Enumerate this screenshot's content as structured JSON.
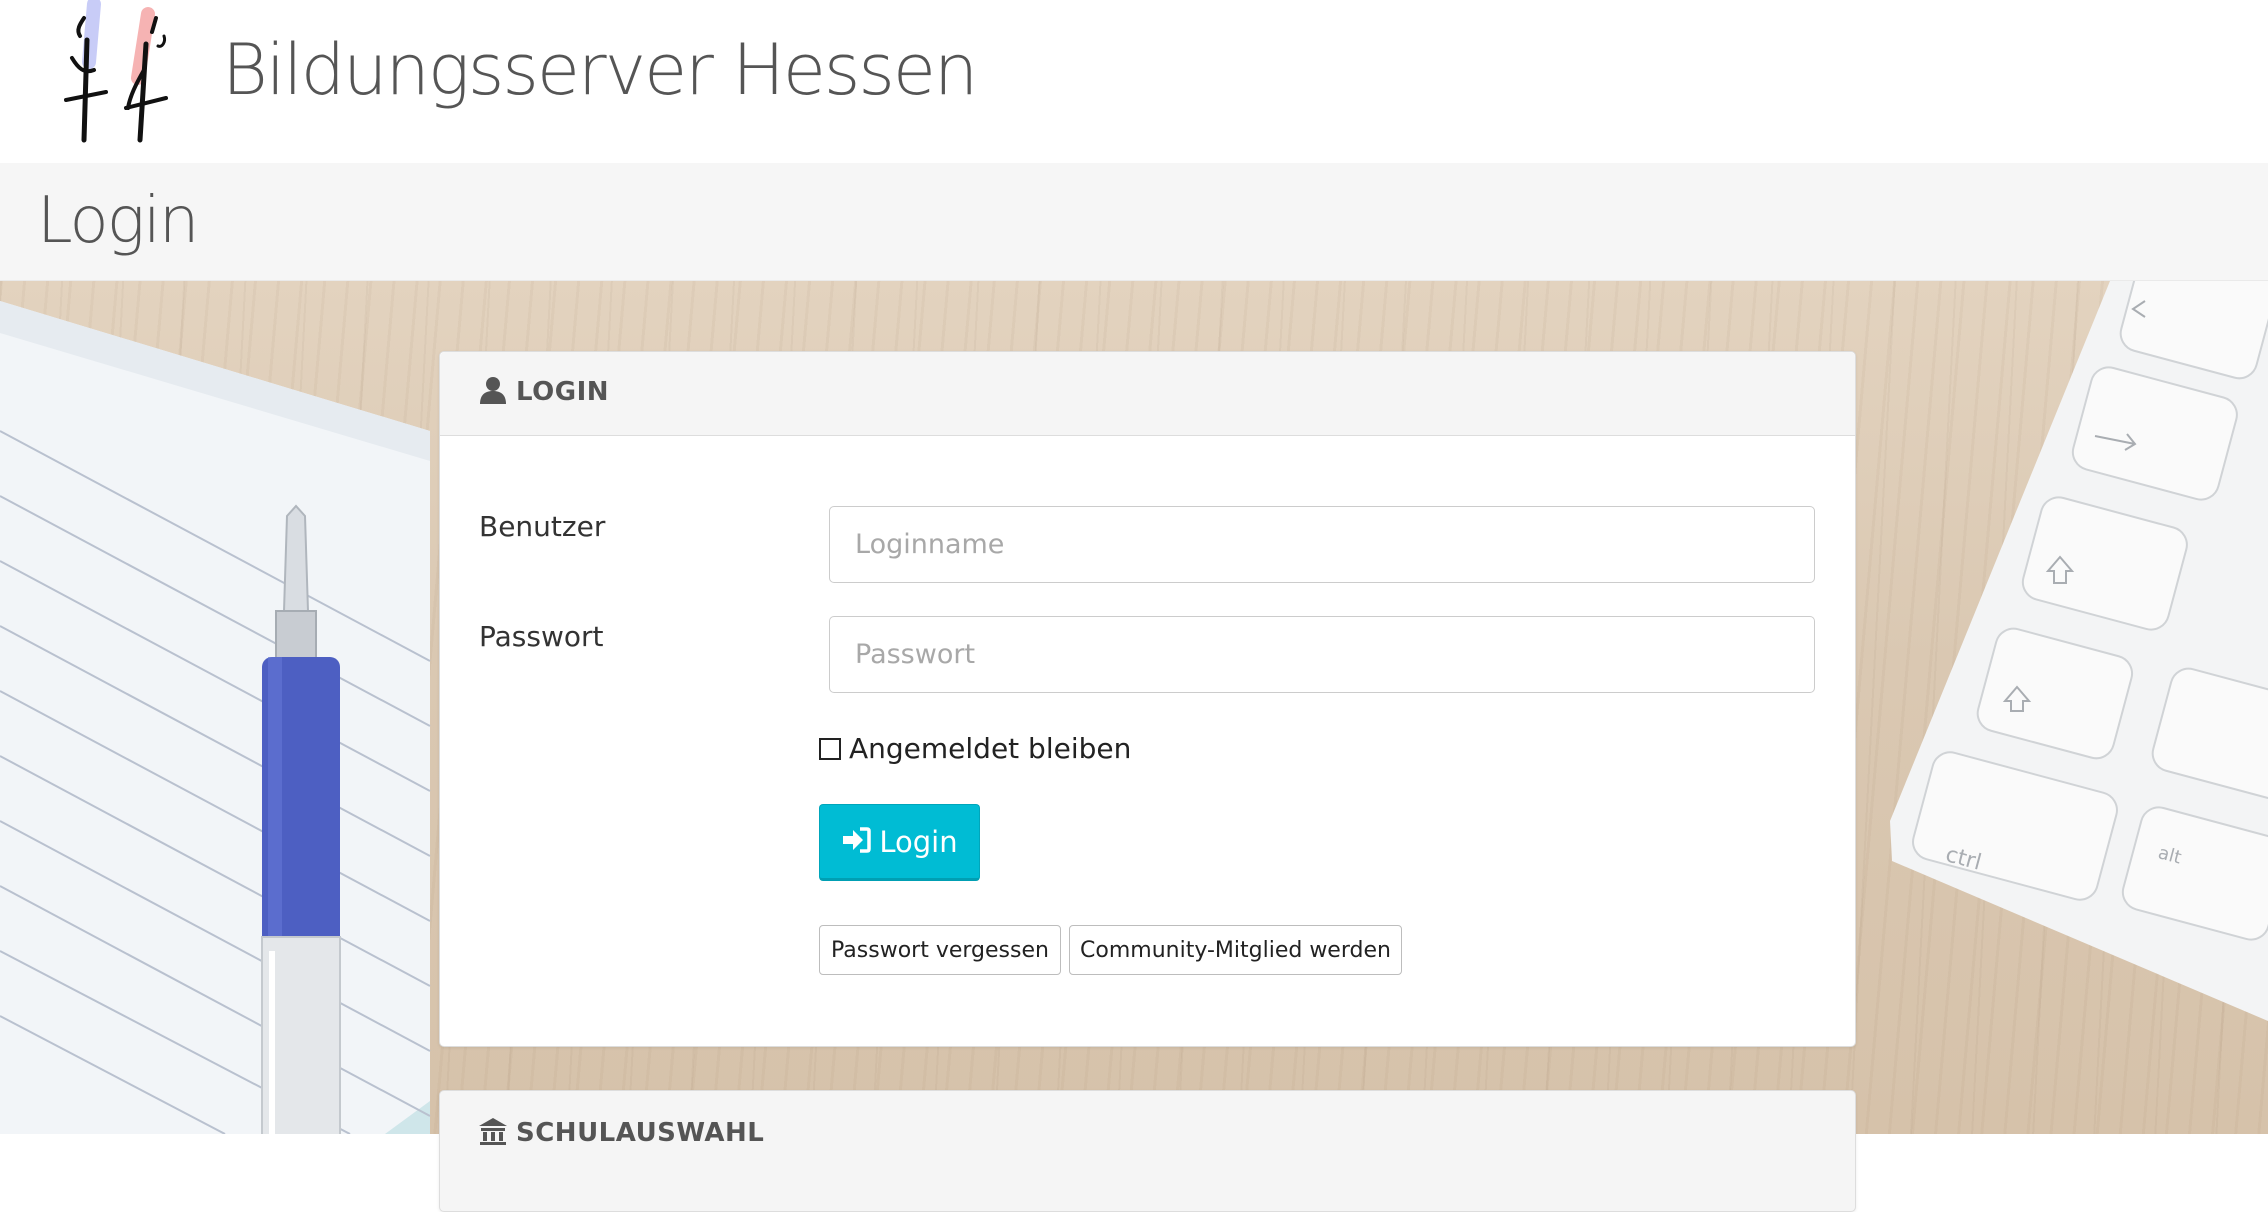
{
  "header": {
    "logo_icon": "bildungsserver-logo-icon",
    "site_title": "Bildungsserver Hessen"
  },
  "page": {
    "title": "Login"
  },
  "background": {
    "image_description_icon": "desk-background-image"
  },
  "login_card": {
    "header_icon": "user-icon",
    "header_title": "LOGIN",
    "user_label": "Benutzer",
    "user_placeholder": "Loginname",
    "user_value": "",
    "password_label": "Passwort",
    "password_placeholder": "Passwort",
    "password_value": "",
    "remember_label": "Angemeldet bleiben",
    "remember_checked": false,
    "login_button_icon": "sign-in-icon",
    "login_button_label": "Login",
    "forgot_button_label": "Passwort vergessen",
    "join_button_label": "Community-Mitglied werden"
  },
  "school_card": {
    "header_icon": "institution-icon",
    "header_title": "SCHULAUSWAHL"
  },
  "colors": {
    "accent": "#00bcd4",
    "title_text": "#555555"
  }
}
